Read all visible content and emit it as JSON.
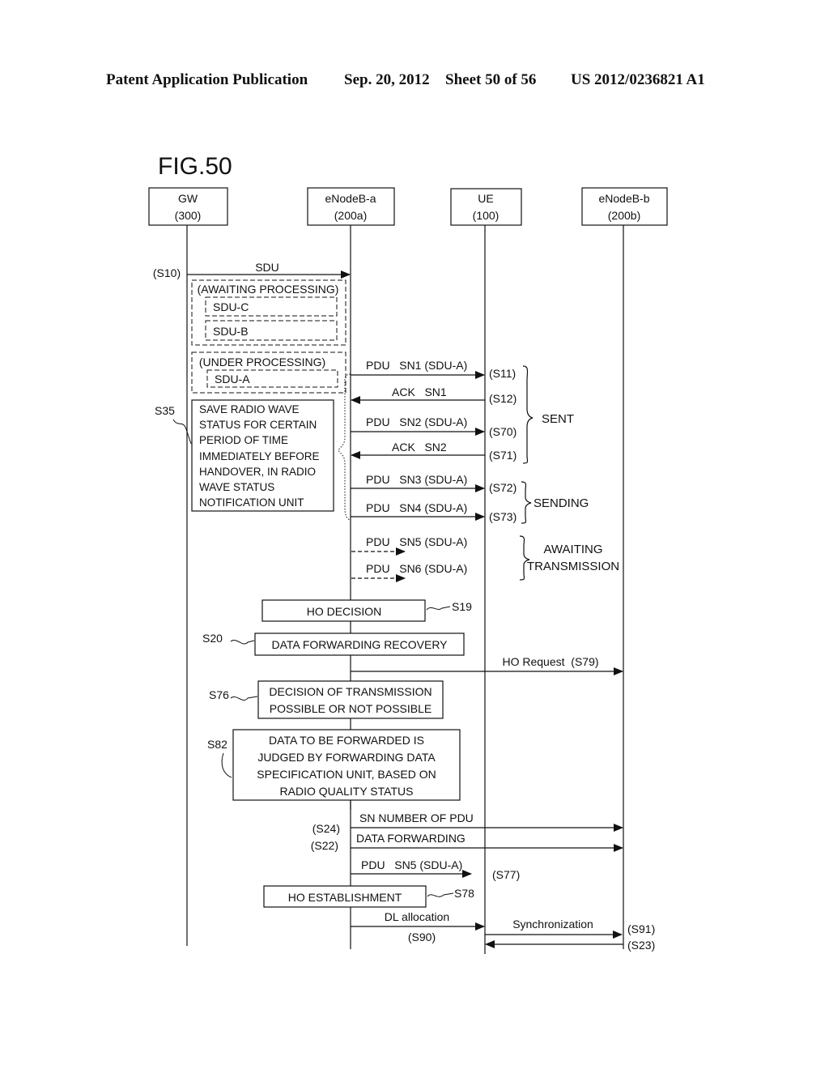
{
  "header": {
    "publication": "Patent Application Publication",
    "date": "Sep. 20, 2012",
    "sheet": "Sheet 50 of 56",
    "number": "US 2012/0236821 A1"
  },
  "figure": {
    "title": "FIG.50",
    "entities": [
      {
        "name": "GW",
        "id": "(300)"
      },
      {
        "name": "eNodeB-a",
        "id": "(200a)"
      },
      {
        "name": "UE",
        "id": "(100)"
      },
      {
        "name": "eNodeB-b",
        "id": "(200b)"
      }
    ],
    "buffer": {
      "awaiting_label": "(AWAITING PROCESSING)",
      "awaiting_items": [
        "SDU-C",
        "SDU-B"
      ],
      "under_label": "(UNDER PROCESSING)",
      "under_items": [
        "SDU-A"
      ]
    },
    "messages": [
      {
        "label": "SDU",
        "step": "(S10)"
      },
      {
        "label": "PDU   SN1 (SDU-A)",
        "step": "(S11)"
      },
      {
        "label": "ACK   SN1",
        "step": "(S12)"
      },
      {
        "label": "PDU   SN2 (SDU-A)",
        "step": "(S70)"
      },
      {
        "label": "ACK   SN2",
        "step": "(S71)"
      },
      {
        "label": "PDU   SN3 (SDU-A)",
        "step": "(S72)"
      },
      {
        "label": "PDU   SN4 (SDU-A)",
        "step": "(S73)"
      },
      {
        "label": "PDU   SN5 (SDU-A)",
        "step": ""
      },
      {
        "label": "PDU   SN6 (SDU-A)",
        "step": ""
      },
      {
        "label": "HO Request  (S79)",
        "step": ""
      },
      {
        "label": "SN NUMBER OF PDU",
        "step": "(S24)"
      },
      {
        "label": "DATA FORWARDING",
        "step": "(S22)"
      },
      {
        "label": "PDU   SN5 (SDU-A)",
        "step": "(S77)"
      },
      {
        "label": "DL allocation",
        "step": "(S90)"
      },
      {
        "label": "Synchronization",
        "step": "(S91)"
      },
      {
        "label": "",
        "step": "(S23)"
      }
    ],
    "groups": {
      "sent": "SENT",
      "sending": "SENDING",
      "awaiting": [
        "AWAITING",
        "TRANSMISSION"
      ]
    },
    "process_boxes": [
      {
        "step": "S35",
        "lines": [
          "SAVE  RADIO WAVE",
          "STATUS FOR CERTAIN",
          "PERIOD OF TIME",
          "IMMEDIATELY BEFORE",
          "HANDOVER, IN RADIO",
          "WAVE STATUS",
          "NOTIFICATION UNIT"
        ]
      },
      {
        "step": "S19",
        "lines": [
          "HO DECISION"
        ]
      },
      {
        "step": "S20",
        "lines": [
          "DATA FORWARDING RECOVERY"
        ]
      },
      {
        "step": "S76",
        "lines": [
          "DECISION OF TRANSMISSION",
          "POSSIBLE OR NOT POSSIBLE"
        ]
      },
      {
        "step": "S82",
        "lines": [
          "DATA TO BE FORWARDED IS",
          "JUDGED BY FORWARDING DATA",
          "SPECIFICATION UNIT, BASED ON",
          "RADIO QUALITY STATUS"
        ]
      },
      {
        "step": "S78",
        "lines": [
          "HO ESTABLISHMENT"
        ]
      }
    ]
  }
}
